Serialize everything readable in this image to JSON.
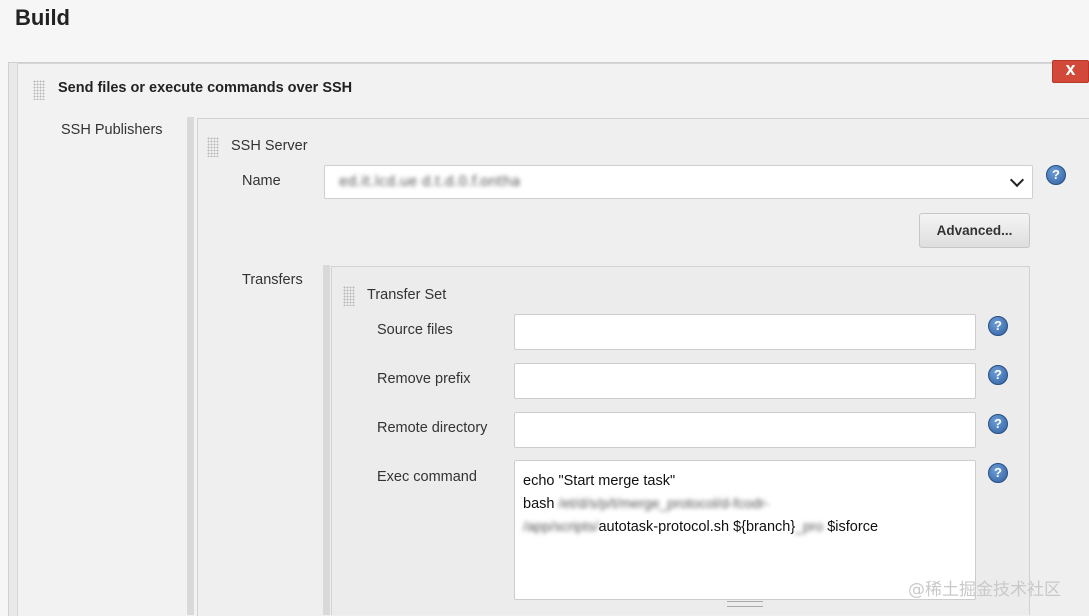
{
  "page": {
    "title": "Build"
  },
  "step": {
    "title": "Send files or execute commands over SSH",
    "delete_label": "X",
    "publishers_label": "SSH Publishers"
  },
  "ssh_server": {
    "heading": "SSH Server",
    "name_label": "Name",
    "name_value": "ed.it.lcd.ue  d.t.d.0.f.ontha",
    "advanced_label": "Advanced...",
    "transfers_label": "Transfers"
  },
  "transfer_set": {
    "heading": "Transfer Set",
    "source_files_label": "Source files",
    "source_files_value": "",
    "remove_prefix_label": "Remove prefix",
    "remove_prefix_value": "",
    "remote_directory_label": "Remote directory",
    "remote_directory_value": "",
    "exec_command_label": "Exec command",
    "exec_lines": {
      "line1": "echo \"Start merge task\"",
      "line2_prefix": "bash",
      "line2_blurred": " /et/d/s/p/t/merge_protocol/d-fcodr-",
      "line3_blurred": "/app/scripts/",
      "line3_text": "autotask-protocol.sh ${branch}",
      "line3_blurred2": "_pro",
      "line3_tail": " $isforce"
    }
  },
  "help_icon_glyph": "?",
  "watermark": "@稀土掘金技术社区"
}
